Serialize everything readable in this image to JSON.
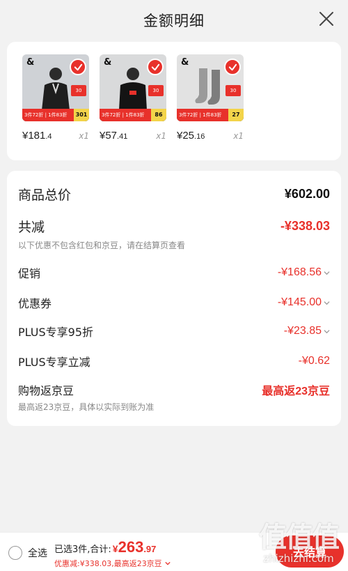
{
  "header": {
    "title": "金额明细"
  },
  "products": [
    {
      "brand": "&",
      "promo_left": "3件72折 | 1件83折",
      "promo_right": "301",
      "side_badge": "30",
      "price_int": "¥181",
      "price_dec": ".4",
      "qty": "x1",
      "thumb_color": "#cfd2d6"
    },
    {
      "brand": "&",
      "promo_left": "3件72折 | 1件83折",
      "promo_right": "86",
      "side_badge": "30",
      "price_int": "¥57",
      "price_dec": ".41",
      "qty": "x1",
      "thumb_color": "#d9dadb"
    },
    {
      "brand": "&",
      "promo_left": "3件72折 | 1件83折",
      "promo_right": "27",
      "side_badge": "30",
      "price_int": "¥25",
      "price_dec": ".16",
      "qty": "x1",
      "thumb_color": "#e2e2e2"
    }
  ],
  "summary": {
    "total_label": "商品总价",
    "total_value": "¥602.00",
    "reduce_label": "共减",
    "reduce_value": "-¥338.03",
    "reduce_note": "以下优惠不包含红包和京豆，请在结算页查看",
    "promo_label": "促销",
    "promo_value": "-¥168.56",
    "coupon_label": "优惠券",
    "coupon_value": "-¥145.00",
    "plus95_label": "PLUS专享95折",
    "plus95_value": "-¥23.85",
    "plusminus_label": "PLUS专享立减",
    "plusminus_value": "-¥0.62",
    "jingdou_label": "购物返京豆",
    "jingdou_value": "最高返23京豆",
    "jingdou_note": "最高返23京豆，具体以实际到账为准"
  },
  "bottom": {
    "select_all": "全选",
    "selected_text": "已选3件,合计:",
    "currency": "¥",
    "amount_int": "263",
    "amount_dec": ".97",
    "discount_text": "优惠减:¥338.03,最高返23京豆",
    "checkout": "去结算"
  },
  "watermark": {
    "glyphs": "值值值",
    "url": "zhizhizhi.com"
  },
  "colors": {
    "accent": "#e8312b",
    "background": "#f2f2f2"
  }
}
